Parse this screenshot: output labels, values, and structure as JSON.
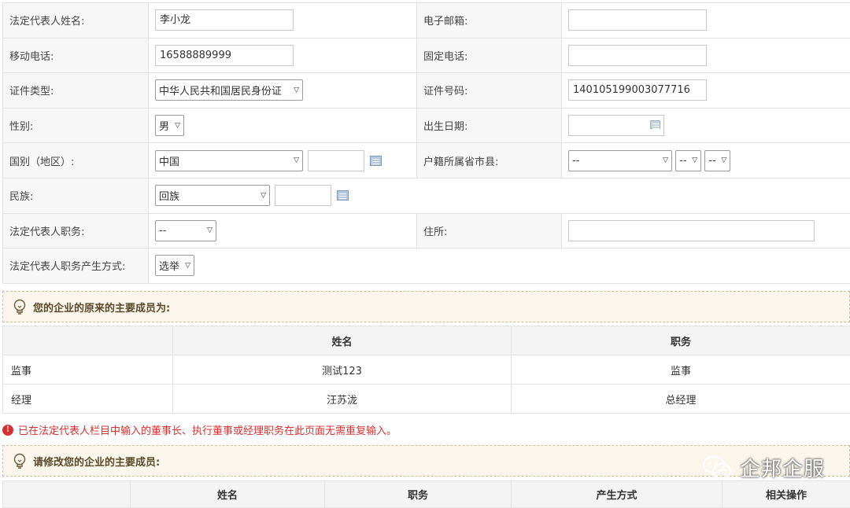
{
  "form": {
    "legal_rep_name_label": "法定代表人姓名:",
    "legal_rep_name_value": "李小龙",
    "email_label": "电子邮箱:",
    "email_value": "",
    "mobile_label": "移动电话:",
    "mobile_value": "16588889999",
    "landline_label": "固定电话:",
    "landline_value": "",
    "id_type_label": "证件类型:",
    "id_type_value": "中华人民共和国居民身份证",
    "id_number_label": "证件号码:",
    "id_number_value": "140105199003077716",
    "gender_label": "性别:",
    "gender_value": "男",
    "birth_label": "出生日期:",
    "birth_value": "",
    "country_label": "国别（地区）:",
    "country_value": "中国",
    "country_text": "",
    "household_label": "户籍所属省市县:",
    "household_province": "--",
    "household_city": "--",
    "household_county": "--",
    "ethnic_label": "民族:",
    "ethnic_value": "回族",
    "ethnic_text": "",
    "position_label": "法定代表人职务:",
    "position_value": "--",
    "address_label": "住所:",
    "address_value": "",
    "appoint_method_label": "法定代表人职务产生方式:",
    "appoint_method_value": "选举"
  },
  "original_members": {
    "title": "您的企业的原来的主要成员为:",
    "columns": [
      "",
      "姓名",
      "职务"
    ],
    "rows": [
      {
        "role": "监事",
        "name": "测试123",
        "position": "监事"
      },
      {
        "role": "经理",
        "name": "汪苏泷",
        "position": "总经理"
      }
    ]
  },
  "warning": {
    "icon": "exclamation-circle-icon",
    "text": "已在法定代表人栏目中输入的董事长、执行董事或经理职务在此页面无需重复输入。"
  },
  "edit_members": {
    "title": "请修改您的企业的主要成员:",
    "columns": [
      "",
      "姓名",
      "职务",
      "产生方式",
      "相关操作"
    ]
  },
  "watermark": {
    "icon": "wechat-icon",
    "text": "企邦企服"
  },
  "colors": {
    "label_bg": "#f7f7f7",
    "tip_bg": "#faf6ec",
    "tip_border": "#cdbf97",
    "warning_red": "#d9302f"
  }
}
